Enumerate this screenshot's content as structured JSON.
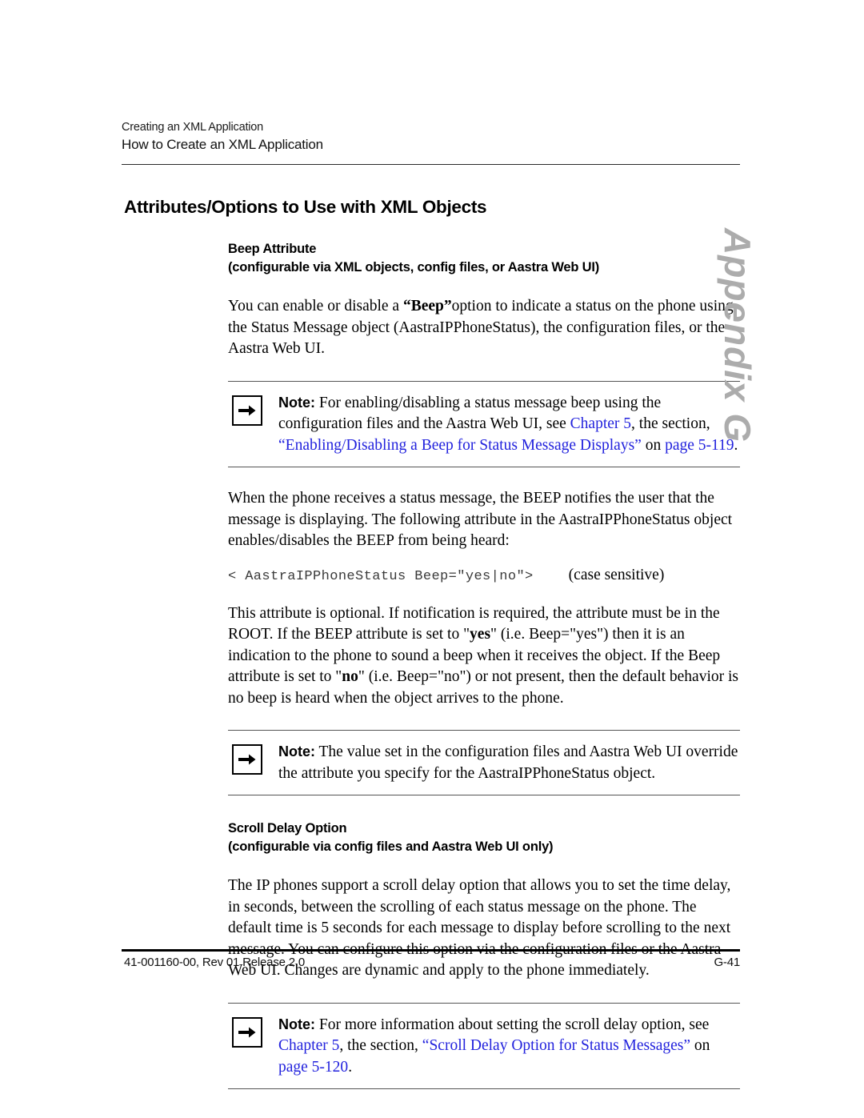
{
  "header": {
    "chapter_title": "Creating an XML Application",
    "section_title": "How to Create an XML Application"
  },
  "heading": "Attributes/Options to Use with XML Objects",
  "appendix_tab": {
    "label": "Appendix G",
    "color": "#acacac"
  },
  "sections": [
    {
      "id": "beep-attribute",
      "heading_line1": "Beep Attribute",
      "heading_line2": "(configurable via XML objects, config files, or Aastra Web UI)",
      "paragraph1_a": "You can enable or disable a ",
      "paragraph1_bold": "“Beep”",
      "paragraph1_b": "option to indicate a status on the phone using the Status Message object (AastraIPPhoneStatus), the configuration files, or the Aastra Web UI.",
      "paragraph2": "When the phone receives a status message, the BEEP notifies the user that the message is displaying. The following attribute in the AastraIPPhoneStatus object enables/disables the BEEP from being heard:",
      "code": "< AastraIPPhoneStatus Beep=\"yes|no\">",
      "code_suffix": "(case sensitive)",
      "paragraph3_a": "This attribute is optional. If notification is required, the attribute must be in the ROOT. If the BEEP attribute is set to \"",
      "paragraph3_bold1": "yes",
      "paragraph3_b": "\" (i.e. Beep=\"yes\") then it is an indication to the phone to sound a beep when it receives the object.  If the Beep attribute is set to \"",
      "paragraph3_bold2": "no",
      "paragraph3_c": "\" (i.e. Beep=\"no\") or not present, then the default behavior is no beep is heard when the object arrives to the phone."
    },
    {
      "id": "scroll-delay-option",
      "heading_line1": "Scroll Delay Option",
      "heading_line2": "(configurable via config files and Aastra Web UI only)",
      "paragraph1": "The IP phones support a scroll delay option that allows you to set the time delay, in seconds, between the scrolling of each status message on the phone. The default time is 5 seconds for each message to display before scrolling to the next message. You can configure this option via the configuration files or the Aastra Web UI. Changes are dynamic and apply to the phone immediately."
    }
  ],
  "notes": [
    {
      "id": "note-beep-config",
      "icon": "arrow-right-icon",
      "label": "Note:",
      "text_a": " For enabling/disabling a status message beep using the configuration files and the Aastra Web UI, see ",
      "link1": "Chapter 5",
      "text_b": ", the section, ",
      "link2": "“Enabling/Disabling a Beep for Status Message Displays”",
      "text_c": " on ",
      "link3": "page 5-119",
      "text_d": "."
    },
    {
      "id": "note-beep-override",
      "icon": "arrow-right-icon",
      "label": "Note:",
      "text_a": " The value set in the configuration files and Aastra Web UI override the attribute you specify for the AastraIPPhoneStatus object."
    },
    {
      "id": "note-scroll-delay",
      "icon": "arrow-right-icon",
      "label": "Note:",
      "text_a": " For more information about setting the scroll delay option, see ",
      "link1": "Chapter 5",
      "text_b": ", the section, ",
      "link2": "“Scroll Delay Option for Status Messages”",
      "text_c": " on ",
      "link3": "page 5-120",
      "text_d": "."
    }
  ],
  "footer": {
    "document_id": "41-001160-00, Rev 01  Release 2.0",
    "page_number": "G-41"
  }
}
